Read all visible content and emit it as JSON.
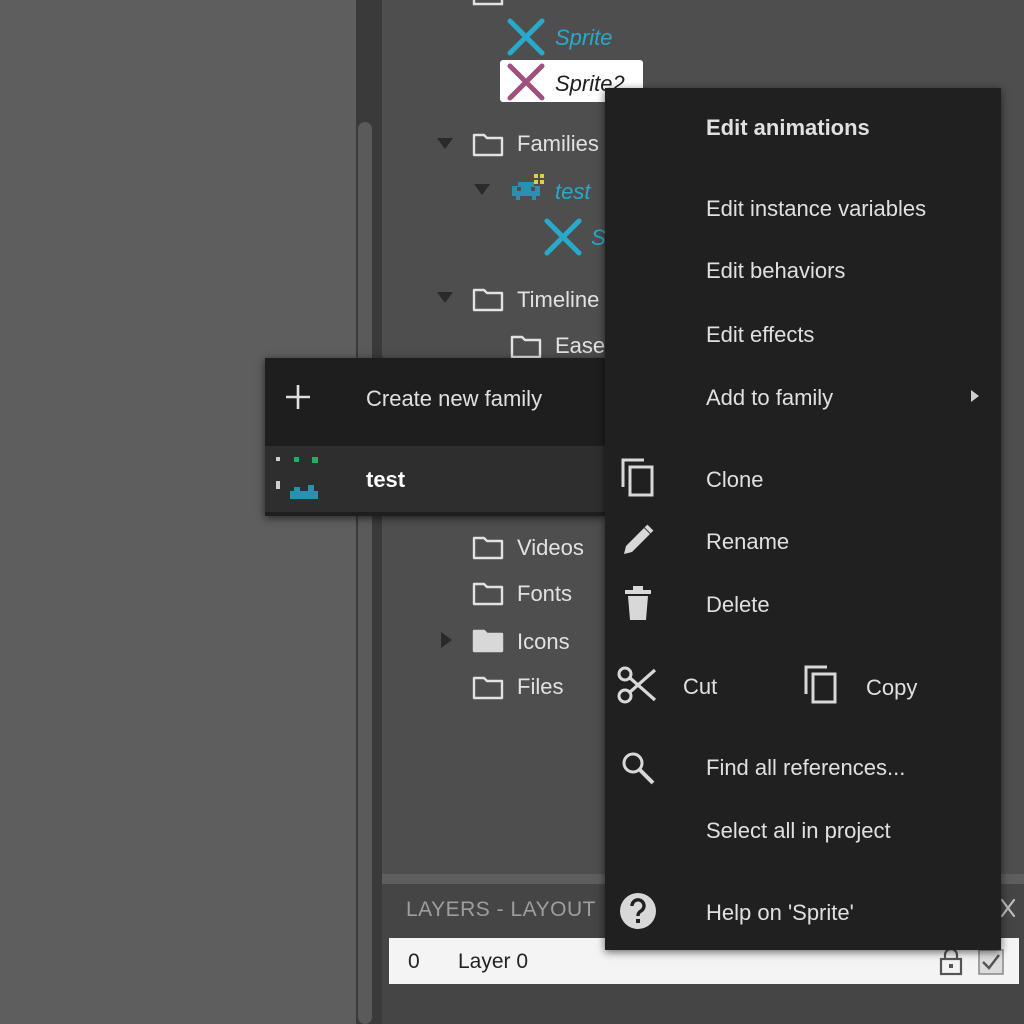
{
  "project_tree": {
    "sprite_label": "Sprite",
    "sprite2_label": "Sprite2",
    "families_label": "Families",
    "family_test_label": "test",
    "family_member_label": "S",
    "timelines_label": "Timeline",
    "eases_label": "Ease",
    "videos_label": "Videos",
    "fonts_label": "Fonts",
    "icons_label": "Icons",
    "files_label": "Files"
  },
  "layers_panel": {
    "title": "LAYERS - LAYOUT",
    "rows": [
      {
        "number": "0",
        "name": "Layer 0"
      }
    ]
  },
  "context_menu": {
    "edit_animations": "Edit animations",
    "edit_instance_variables": "Edit instance variables",
    "edit_behaviors": "Edit behaviors",
    "edit_effects": "Edit effects",
    "add_to_family": "Add to family",
    "clone": "Clone",
    "rename": "Rename",
    "delete": "Delete",
    "cut": "Cut",
    "copy": "Copy",
    "find_all_references": "Find all references...",
    "select_all_in_project": "Select all in project",
    "help": "Help on 'Sprite'"
  },
  "family_submenu": {
    "create_new_family": "Create new family",
    "existing_family": "test"
  },
  "icons": {
    "sprite": "sprite-x-icon",
    "folder": "folder-icon",
    "family": "family-invader-icon",
    "plus": "plus-icon",
    "clone": "clone-icon",
    "rename": "pencil-icon",
    "delete": "trash-icon",
    "cut": "scissors-icon",
    "copy": "copy-icon",
    "find": "search-icon",
    "help": "help-icon",
    "lock": "lock-icon",
    "visible": "checkbox-icon",
    "close": "close-icon"
  },
  "colors": {
    "accent_teal": "#29a9c9",
    "sprite2_purple": "#a0507f",
    "menu_bg": "#202020",
    "panel_bg": "#4e4e4e"
  }
}
